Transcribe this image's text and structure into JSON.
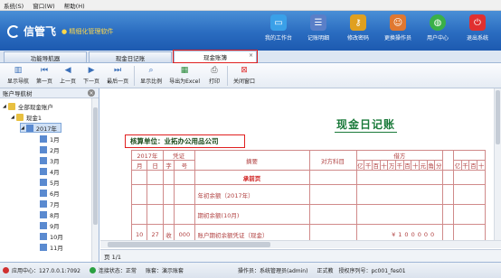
{
  "menu": [
    "系统(S)",
    "窗口(W)",
    "帮助(H)"
  ],
  "brand": {
    "name": "信管飞",
    "slogan": "● 精细化管理软件"
  },
  "tools": [
    {
      "label": "我的工作台",
      "icon": "monitor-icon",
      "color": "#3aa0e8"
    },
    {
      "label": "记账明细",
      "icon": "ledger-list-icon",
      "color": "#5a7fc8"
    },
    {
      "label": "修改密码",
      "icon": "key-user-icon",
      "color": "#e0a020"
    },
    {
      "label": "更换操作员",
      "icon": "user-switch-icon",
      "color": "#e07830"
    },
    {
      "label": "用户中心",
      "icon": "globe-icon",
      "color": "#3ab048"
    },
    {
      "label": "退出系统",
      "icon": "power-icon",
      "color": "#e03030"
    }
  ],
  "tabs": [
    {
      "label": "功能导航器",
      "active": false
    },
    {
      "label": "现金日记账",
      "active": false
    },
    {
      "label": "现金账簿",
      "active": true
    }
  ],
  "toolbar": [
    {
      "label": "显示导航",
      "icon": "sidebar-icon"
    },
    {
      "label": "第一页",
      "icon": "first-page-icon"
    },
    {
      "label": "上一页",
      "icon": "prev-page-icon"
    },
    {
      "label": "下一页",
      "icon": "next-page-icon"
    },
    {
      "label": "最后一页",
      "icon": "last-page-icon"
    },
    {
      "label": "显示比例",
      "icon": "zoom-icon"
    },
    {
      "label": "导出为Excel",
      "icon": "excel-icon"
    },
    {
      "label": "打印",
      "icon": "printer-icon"
    },
    {
      "label": "关闭窗口",
      "icon": "close-window-icon"
    }
  ],
  "sidebar": {
    "title": "账户导航树",
    "root": "全部现金账户",
    "account": "现金1",
    "year": "2017年",
    "months": [
      "1月",
      "2月",
      "3月",
      "4月",
      "5月",
      "6月",
      "7月",
      "8月",
      "9月",
      "10月",
      "11月"
    ]
  },
  "report": {
    "title": "现金日记账",
    "unit": "核算单位：业拓办公用品公司",
    "headers": {
      "year": "2017年",
      "voucher": "凭证",
      "summary": "摘要",
      "subject": "对方科目",
      "debit": "借方",
      "month": "月",
      "day": "日",
      "type": "字",
      "num": "号",
      "digits": [
        "亿",
        "千",
        "百",
        "十",
        "万",
        "千",
        "百",
        "十",
        "元",
        "角",
        "分"
      ]
    },
    "rows": [
      {
        "month": "",
        "day": "",
        "type": "",
        "num": "",
        "summary": "承前页",
        "amount": ""
      },
      {
        "month": "",
        "day": "",
        "type": "",
        "num": "",
        "summary": "年初余额（2017年）",
        "amount": ""
      },
      {
        "month": "",
        "day": "",
        "type": "",
        "num": "",
        "summary": "期初余额(10月)",
        "amount": ""
      },
      {
        "month": "10",
        "day": "27",
        "type": "收",
        "num": "000",
        "summary": "账户期初余额凭证（现金）",
        "amount": "¥100000"
      }
    ]
  },
  "page_info": "页 1/1",
  "status": {
    "app_center": "应用中心：127.0.0.1:7092",
    "connection": "连接状态：正常",
    "book": "账套：演示账套",
    "operator": "操作员：系统管理员(admin)",
    "license": "正式教",
    "serial": "授权序列号：pc001_fes01"
  }
}
